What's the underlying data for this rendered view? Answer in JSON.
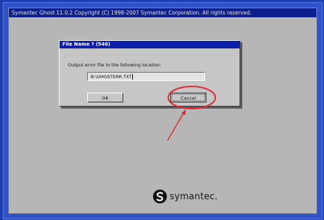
{
  "app": {
    "title": "Symantec Ghost 11.0.2   Copyright (C) 1998-2007 Symantec Corporation. All rights reserved."
  },
  "dialog": {
    "title": "File Name ? (546)",
    "prompt": "Output error file to the following location:",
    "file_value": "B:\\GHOSTERR.TXT",
    "ok_label": "OK",
    "cancel_label": "Cancel"
  },
  "logo": {
    "text": "symantec."
  },
  "colors": {
    "annotation": "#e8242c",
    "title_bar": "#0c1fa8",
    "backdrop": "#3053cc"
  },
  "icons": {
    "logo_mark": "symantec-logo-icon"
  }
}
